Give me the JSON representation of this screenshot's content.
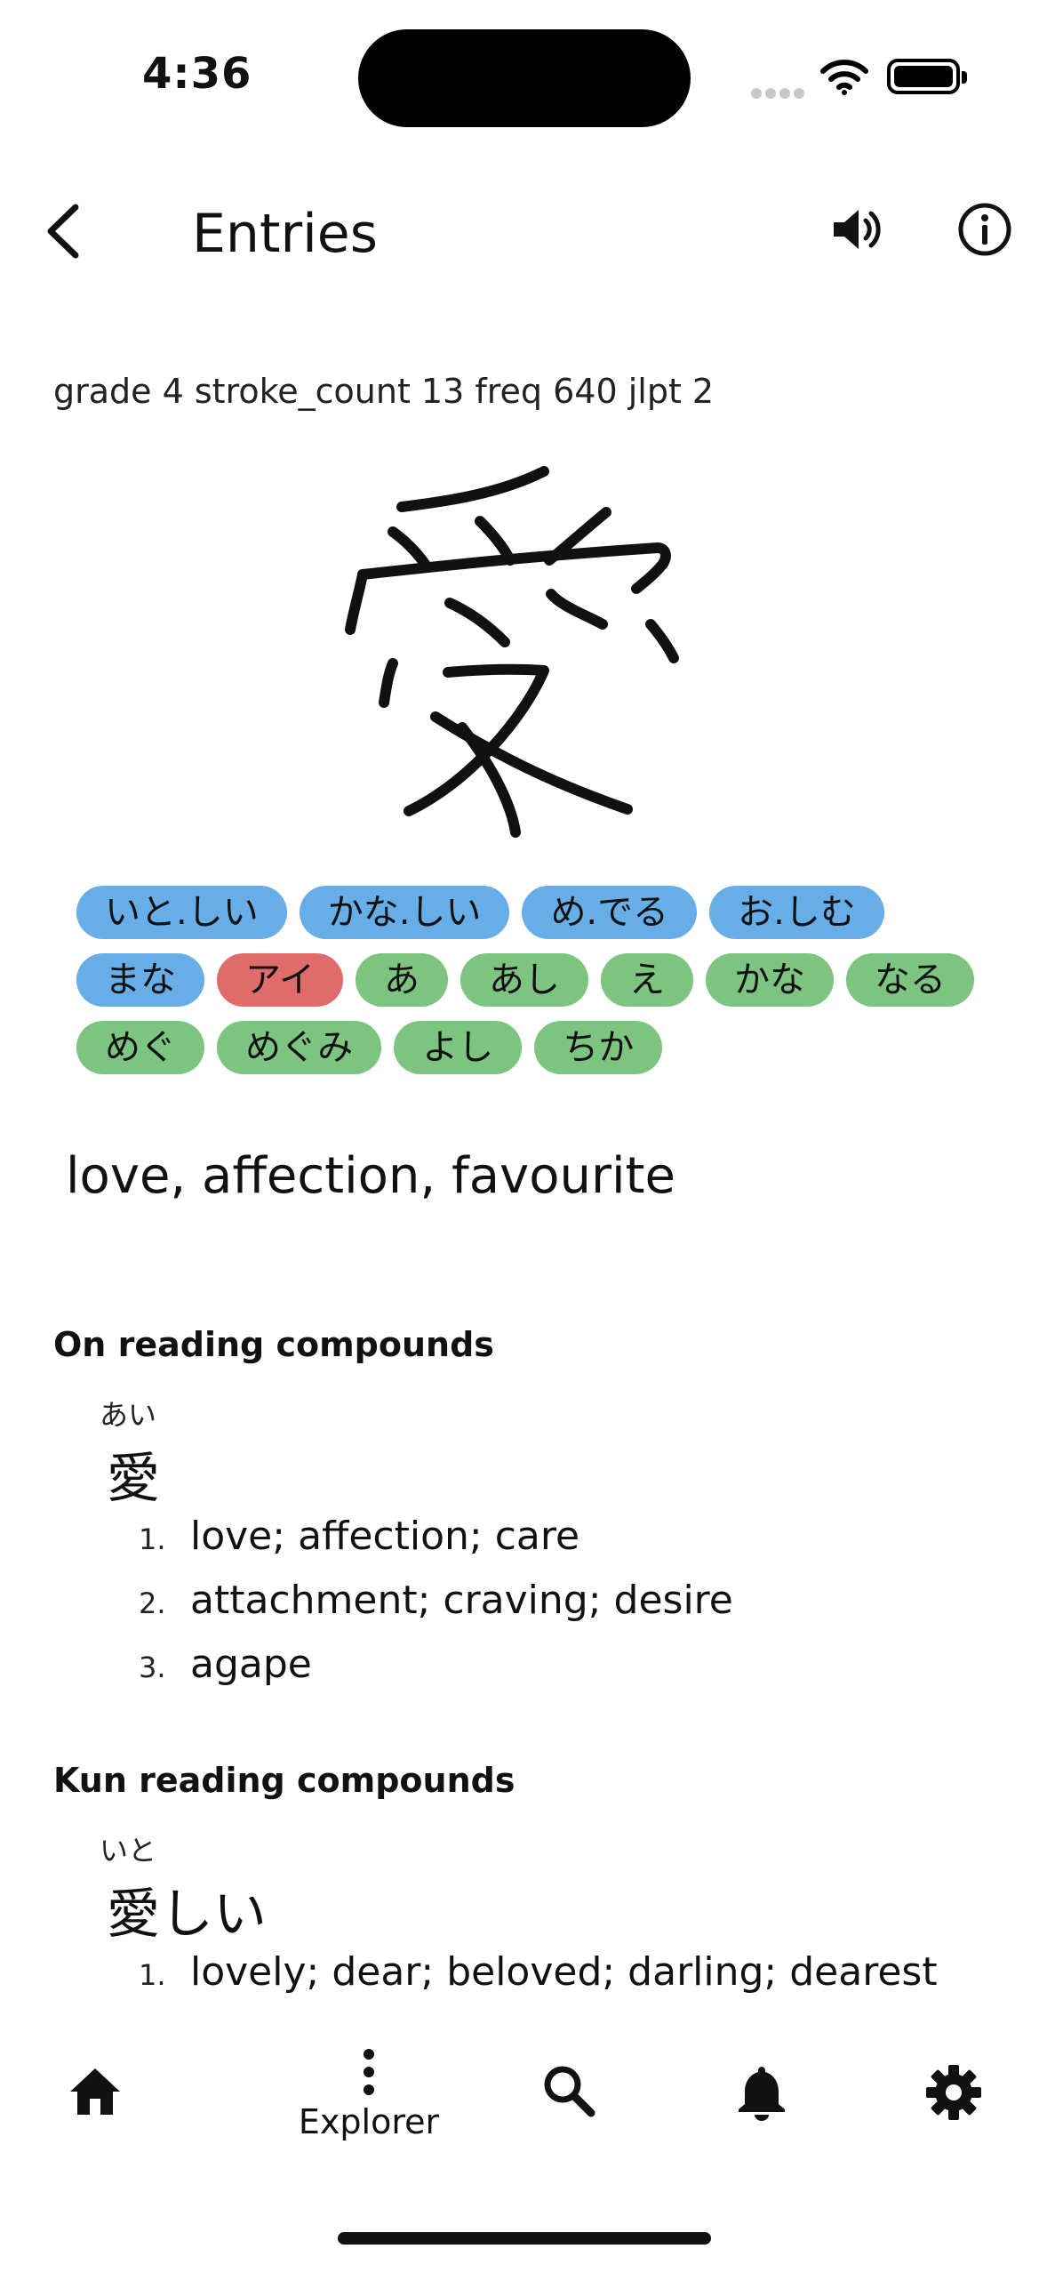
{
  "status_bar": {
    "time": "4:36"
  },
  "header": {
    "title": "Entries",
    "back_icon": "chevron-left-icon",
    "sound_icon": "speaker-icon",
    "info_icon": "info-circle-icon"
  },
  "meta": "grade 4 stroke_count 13 freq 640 jlpt 2",
  "kanji": "愛",
  "readings": {
    "rows": [
      [
        {
          "text": "いと.しい",
          "kind": "kun"
        },
        {
          "text": "かな.しい",
          "kind": "kun"
        },
        {
          "text": "め.でる",
          "kind": "kun"
        },
        {
          "text": "お.しむ",
          "kind": "kun"
        }
      ],
      [
        {
          "text": "まな",
          "kind": "kun"
        },
        {
          "text": "アイ",
          "kind": "on"
        },
        {
          "text": "あ",
          "kind": "nanori"
        },
        {
          "text": "あし",
          "kind": "nanori"
        },
        {
          "text": "え",
          "kind": "nanori"
        },
        {
          "text": "かな",
          "kind": "nanori"
        },
        {
          "text": "なる",
          "kind": "nanori"
        }
      ],
      [
        {
          "text": "めぐ",
          "kind": "nanori"
        },
        {
          "text": "めぐみ",
          "kind": "nanori"
        },
        {
          "text": "よし",
          "kind": "nanori"
        },
        {
          "text": "ちか",
          "kind": "nanori"
        }
      ]
    ],
    "colors": {
      "kun": "#67aee8",
      "on": "#df6b6b",
      "nanori": "#7cc47f"
    }
  },
  "meaning": "love, affection, favourite",
  "on_compounds": {
    "title": "On reading compounds",
    "items": [
      {
        "furigana": "あい",
        "word": "愛",
        "definitions": [
          "love; affection; care",
          "attachment; craving; desire",
          "agape"
        ]
      }
    ]
  },
  "kun_compounds": {
    "title": "Kun reading compounds",
    "items": [
      {
        "furigana": "いと",
        "word": "愛しい",
        "definitions": [
          "lovely; dear; beloved; darling; dearest"
        ]
      }
    ]
  },
  "bottom_nav": {
    "items": [
      {
        "icon": "home-icon",
        "label": ""
      },
      {
        "icon": "more-vertical-icon",
        "label": "Explorer"
      },
      {
        "icon": "search-icon",
        "label": ""
      },
      {
        "icon": "bell-icon",
        "label": ""
      },
      {
        "icon": "gear-icon",
        "label": ""
      }
    ]
  }
}
